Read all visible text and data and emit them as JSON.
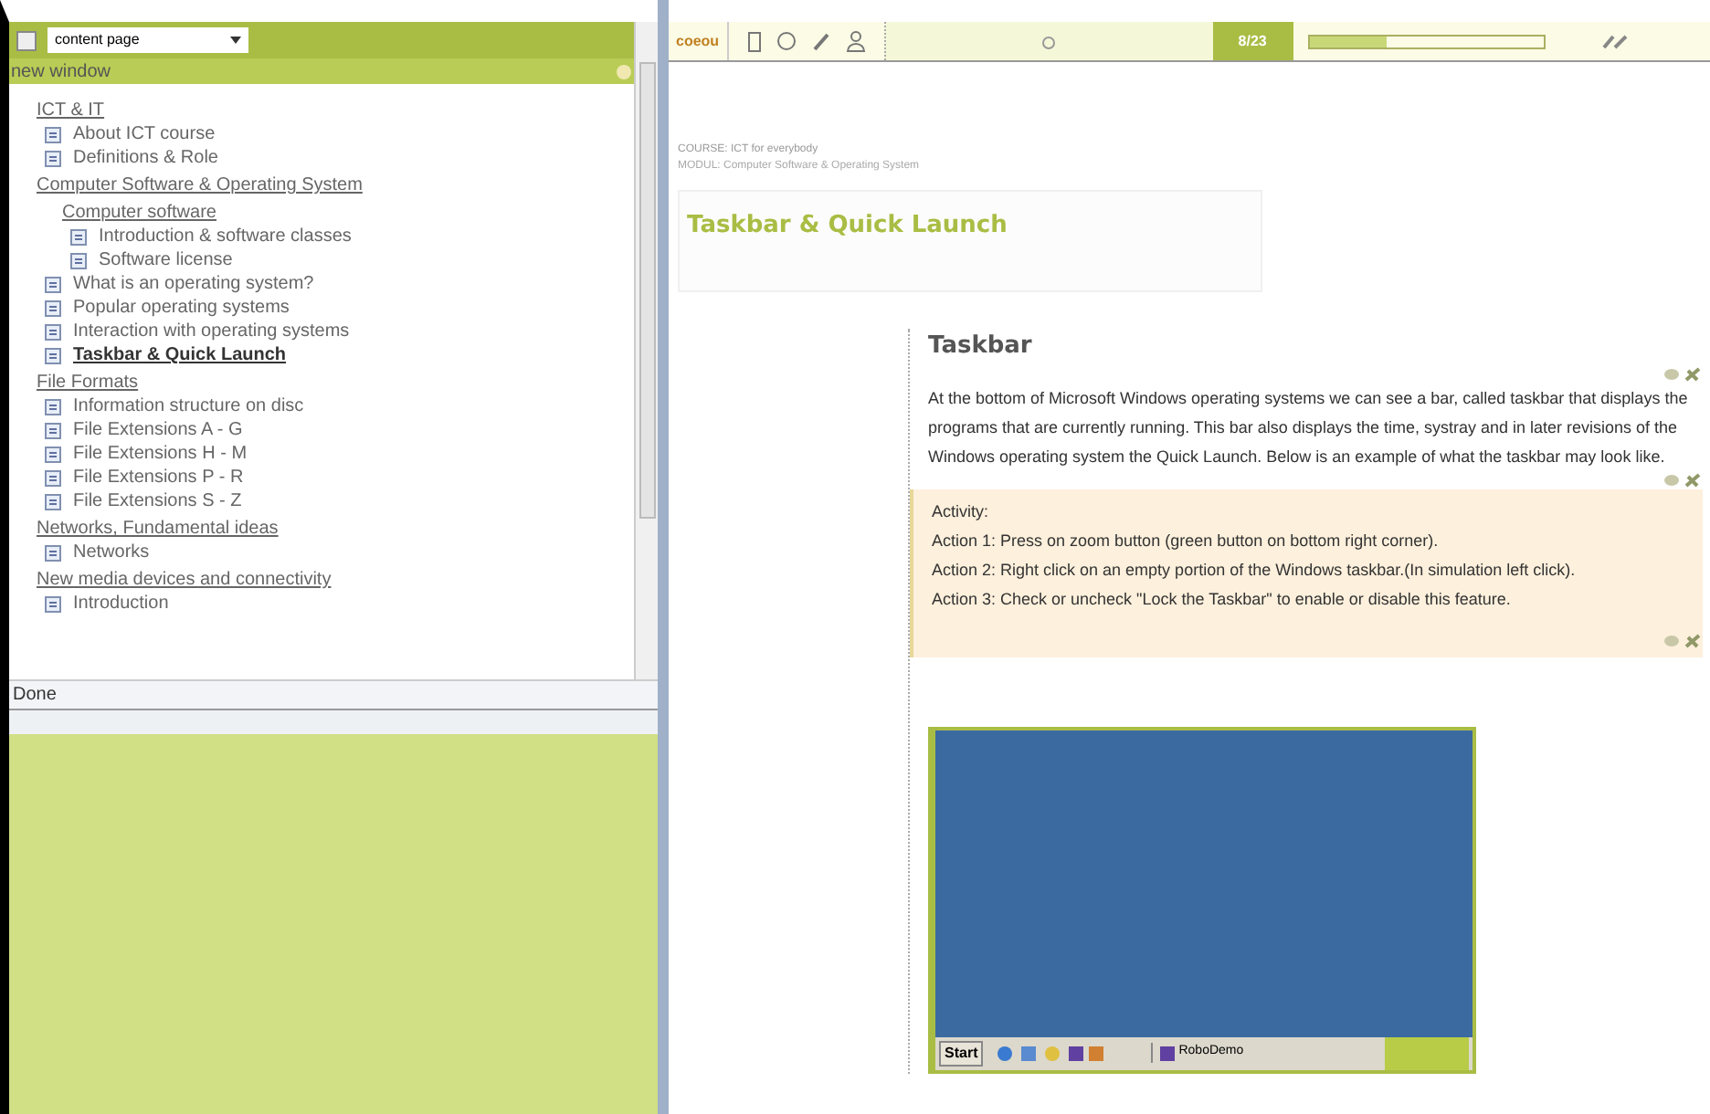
{
  "left_panel": {
    "dropdown": {
      "value": "content page"
    },
    "checkbox": {
      "checked": false
    },
    "header": "new window",
    "tree": [
      {
        "label": "ICT & IT",
        "kind": "section",
        "selected": false,
        "children": [
          {
            "label": "About ICT course",
            "kind": "page",
            "selected": false
          },
          {
            "label": "Definitions & Role",
            "kind": "page",
            "selected": false
          }
        ]
      },
      {
        "label": "Computer Software & Operating System",
        "kind": "section",
        "selected": false,
        "children": [
          {
            "label": "Computer software",
            "kind": "section",
            "selected": false,
            "children": [
              {
                "label": "Introduction & software classes",
                "kind": "page",
                "selected": false
              },
              {
                "label": "Software license",
                "kind": "page",
                "selected": false
              }
            ]
          },
          {
            "label": "What is an operating system?",
            "kind": "page",
            "selected": false
          },
          {
            "label": "Popular operating systems",
            "kind": "page",
            "selected": false
          },
          {
            "label": "Interaction with operating systems",
            "kind": "page",
            "selected": false
          },
          {
            "label": "Taskbar & Quick Launch",
            "kind": "page",
            "selected": true
          }
        ]
      },
      {
        "label": "File Formats",
        "kind": "section",
        "selected": false,
        "children": [
          {
            "label": "Information structure on disc",
            "kind": "page",
            "selected": false
          },
          {
            "label": "File Extensions A - G",
            "kind": "page",
            "selected": false
          },
          {
            "label": "File Extensions H - M",
            "kind": "page",
            "selected": false
          },
          {
            "label": "File Extensions P - R",
            "kind": "page",
            "selected": false
          },
          {
            "label": "File Extensions S - Z",
            "kind": "page",
            "selected": false
          }
        ]
      },
      {
        "label": "Networks, Fundamental ideas",
        "kind": "section",
        "selected": false,
        "children": [
          {
            "label": "Networks",
            "kind": "page",
            "selected": false
          }
        ]
      },
      {
        "label": "New media devices and connectivity",
        "kind": "section",
        "selected": false,
        "children": [
          {
            "label": "Introduction",
            "kind": "page",
            "selected": false
          }
        ]
      }
    ],
    "status": "Done"
  },
  "toolbar": {
    "logo": "coeou",
    "page_counter": "8/23",
    "progress": {
      "level": 0.33
    }
  },
  "content": {
    "course": "COURSE: ICT for everybody",
    "module": "MODUL: Computer Software & Operating System",
    "title": "Taskbar & Quick Launch",
    "heading": "Taskbar",
    "paragraph": "At the bottom of Microsoft Windows operating systems we can see a bar, called taskbar that displays the programs that are currently running. This bar also displays the time, systray and in later revisions of the Windows operating system the Quick Launch. Below is an example of what the taskbar may look like.",
    "activity": [
      "Activity:",
      "Action 1: Press on zoom button (green button on bottom right corner).",
      "Action 2: Right click on an empty portion of the Windows taskbar.(In simulation left click).",
      "Action 3: Check or uncheck \"Lock the Taskbar\" to enable or disable this feature."
    ],
    "screenshot": {
      "start": "Start",
      "task": "RoboDemo"
    }
  }
}
